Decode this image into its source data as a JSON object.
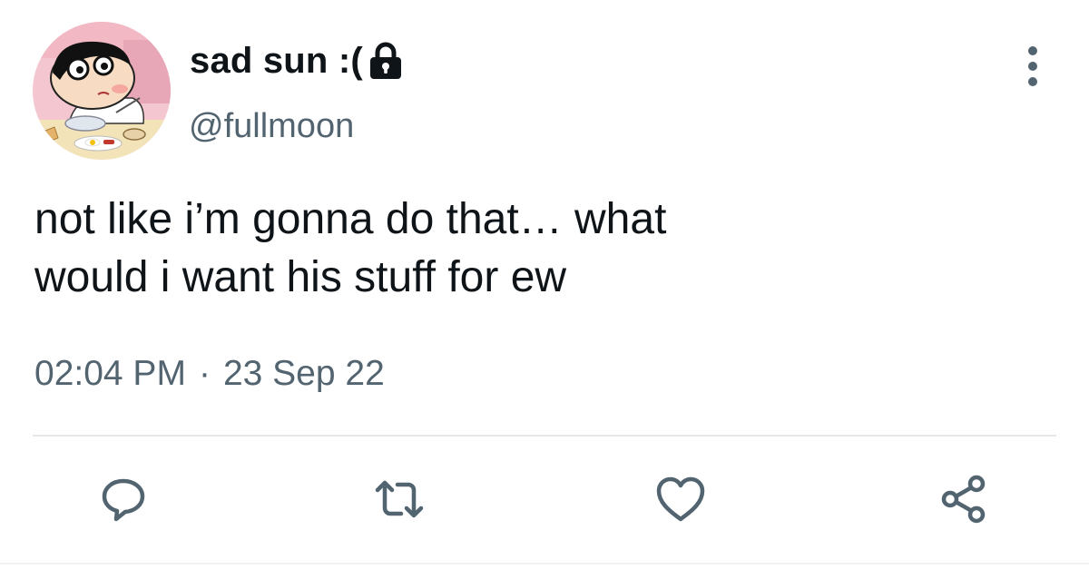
{
  "tweet": {
    "display_name": "sad sun :(",
    "handle": "@fullmoon",
    "text": "not like i’m gonna do that… what\nwould i want his stuff for ew",
    "time": "02:04 PM",
    "separator": "·",
    "date": "23 Sep 22",
    "protected": true
  },
  "icons": {
    "lock": "lock-icon",
    "more": "vertical-dots-icon",
    "reply": "speech-bubble-icon",
    "retweet": "retweet-arrows-icon",
    "like": "heart-icon",
    "share": "share-nodes-icon"
  },
  "colors": {
    "text_primary": "#0f1419",
    "text_secondary": "#536471",
    "divider": "#e6e9eb"
  }
}
